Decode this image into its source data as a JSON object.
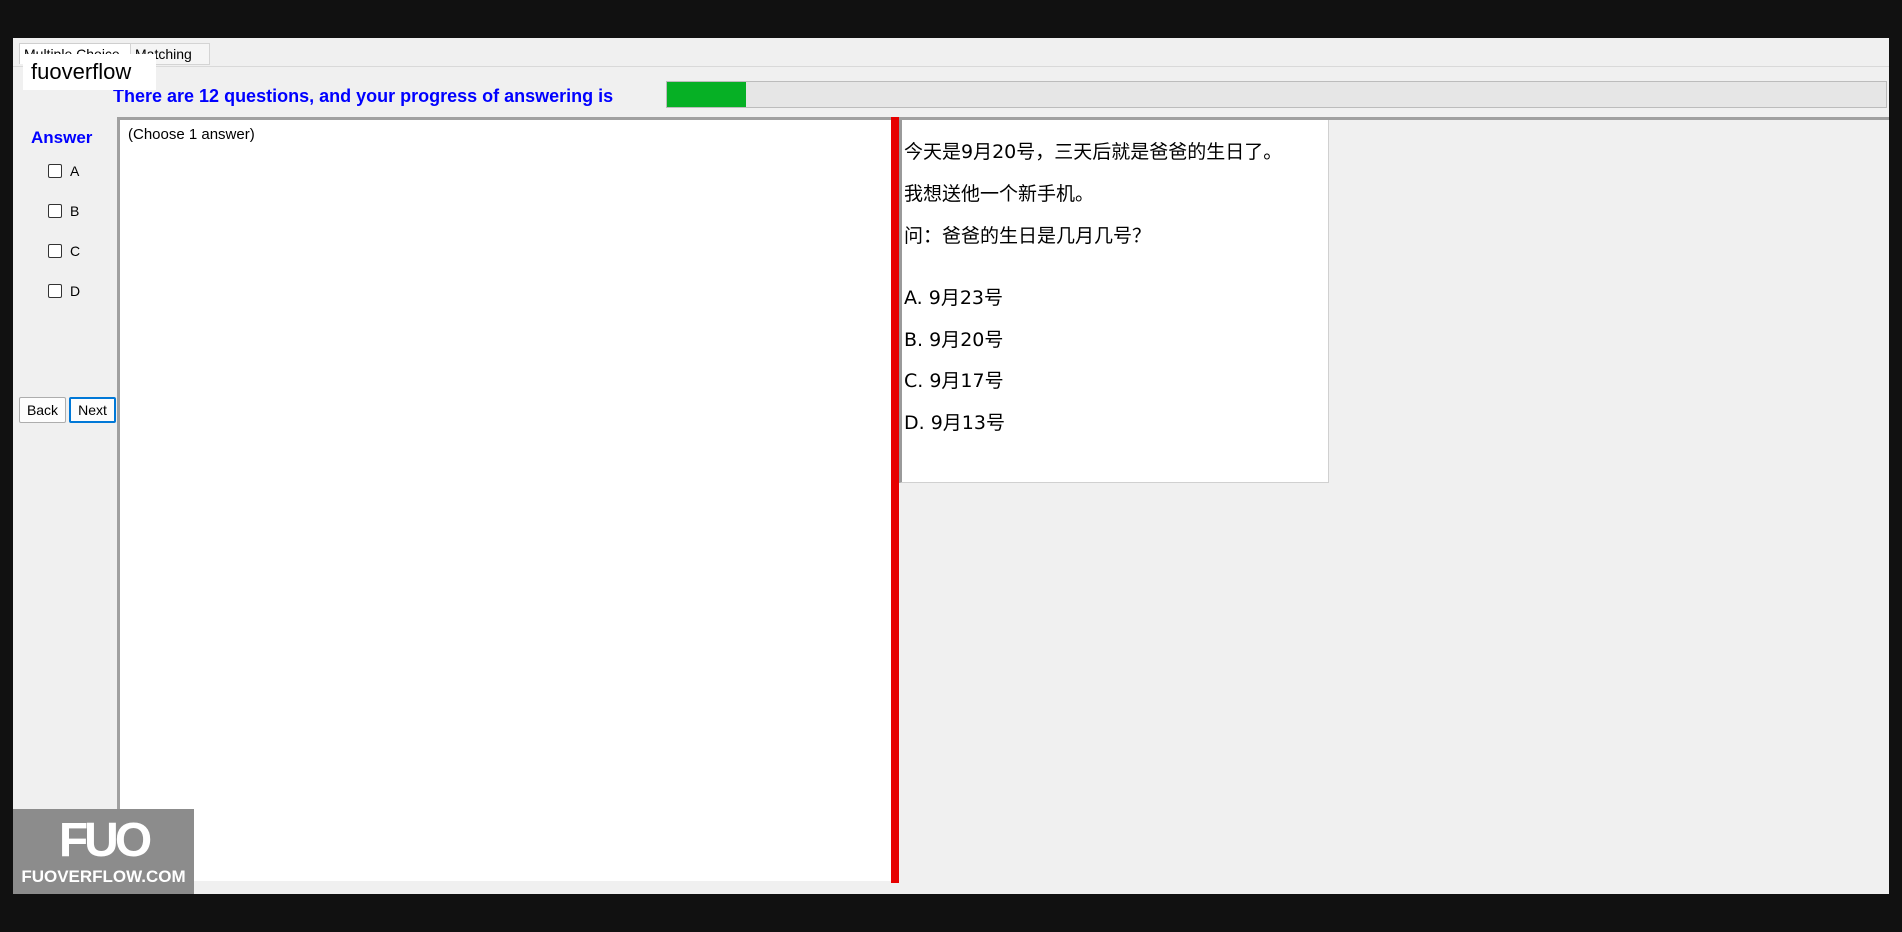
{
  "tabs": [
    {
      "label": "Multiple Choice"
    },
    {
      "label": "Matching"
    }
  ],
  "overlay_label": "fuoverflow",
  "progress": {
    "text": "There are 12 questions, and your progress of answering is",
    "fraction": 0.065,
    "fill_color": "#06b025"
  },
  "answer": {
    "heading": "Answer",
    "options": [
      {
        "label": "A",
        "checked": false
      },
      {
        "label": "B",
        "checked": false
      },
      {
        "label": "C",
        "checked": false
      },
      {
        "label": "D",
        "checked": false
      }
    ]
  },
  "buttons": {
    "back": "Back",
    "next": "Next"
  },
  "instruction": "(Choose 1 answer)",
  "question": {
    "lines": [
      "今天是9月20号，三天后就是爸爸的生日了。",
      "我想送他一个新手机。",
      "问：爸爸的生日是几月几号？"
    ],
    "choices": [
      "A.  9月23号",
      "B.  9月20号",
      "C.  9月17号",
      "D.  9月13号"
    ]
  },
  "watermark": {
    "url": "FUOVERFLOW.COM"
  },
  "colors": {
    "accent_text": "#0000ff",
    "divider": "#e60000"
  }
}
